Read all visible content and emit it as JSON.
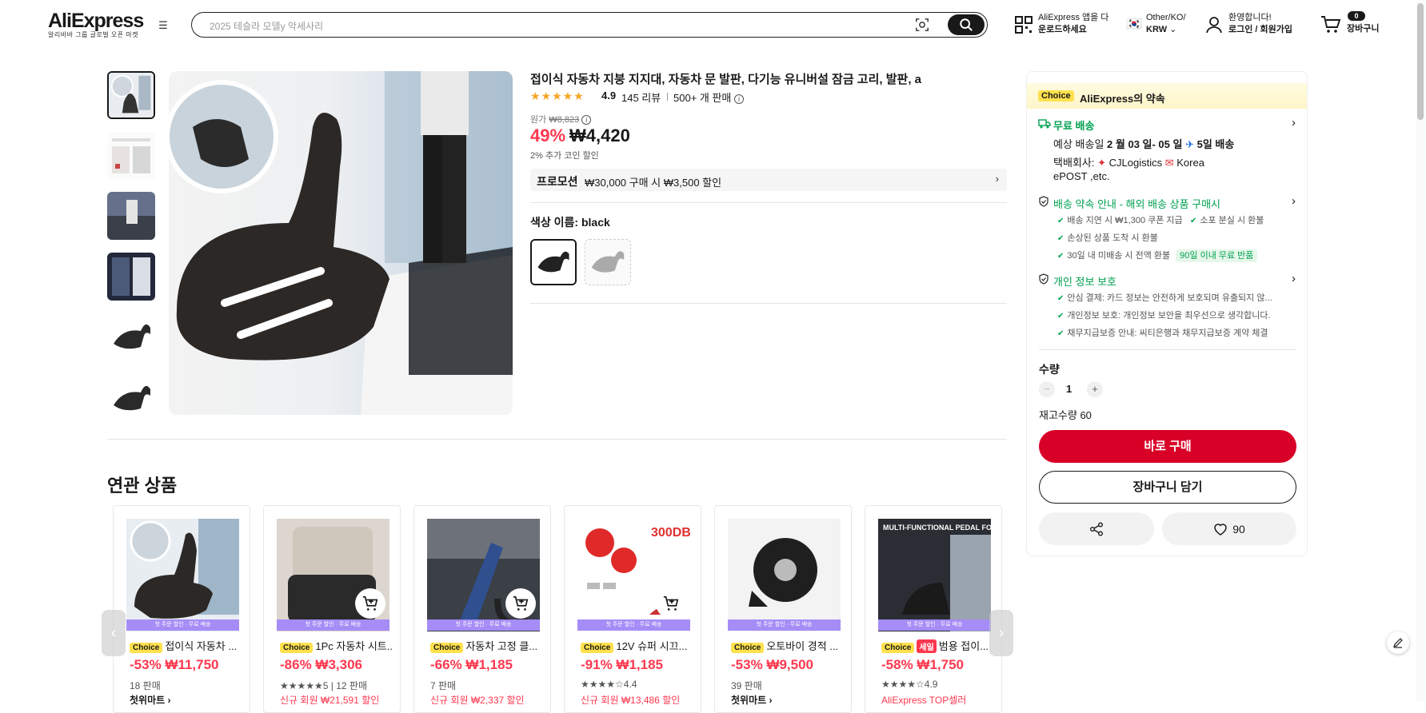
{
  "header": {
    "logo": "AliExpress",
    "logo_sub": "알리바바 그룹 글로벌 오픈 마켓",
    "search_placeholder": "2025 테슬라 모델y 악세사리",
    "app_line1": "AliExpress 앱을 다",
    "app_line2": "운로드하세요",
    "region_line1": "Other/KO/",
    "region_line2": "KRW",
    "account_line1": "환영합니다!",
    "account_line2": "로그인 / 회원가입",
    "cart_count": "0",
    "cart_label": "장바구니"
  },
  "product": {
    "title": "접이식 자동차 지붕 지지대, 자동차 문 발판, 다기능 유니버설 잠금 고리, 발판, a",
    "stars": "★★★★★",
    "rating": "4.9",
    "reviews": "145 리뷰",
    "sold": "500+ 개 판매",
    "orig_label": "원가",
    "orig_price": "₩8,823",
    "discount": "49%",
    "price": "₩4,420",
    "coin": "2% 추가 코인 할인",
    "promo_tag": "프로모션",
    "promo_text": "₩30,000 구매 시 ₩3,500 할인",
    "color_label": "색상 이름: black",
    "thumb_count": 6
  },
  "panel": {
    "choice": "Choice",
    "promise": "AliExpress의 약속",
    "free_ship": "무료 배송",
    "delivery_prefix": "예상 배송일",
    "delivery_date": "2 월 03 일- 05 일",
    "delivery_days": "5일 배송",
    "carrier_label": "택배회사:",
    "carrier1": "CJLogistics",
    "carrier2": "Korea",
    "carrier3": "ePOST ,etc.",
    "guarantee_title": "배송 약속 안내 - 해외 배송 상품 구매시",
    "g1": "배송 지연 시 ₩1,300 쿠폰 지급",
    "g2": "소포 분실 시 환불",
    "g3": "손상된 상품 도착 시 환불",
    "g4": "30일 내 미배송 시 전액 환불",
    "g4_badge": "90일 이내 무료 반품",
    "privacy_title": "개인 정보 보호",
    "p1": "안심 결제: 카드 정보는 안전하게 보호되며 유출되지 않...",
    "p2": "개인정보 보호: 개인정보 보안을 최우선으로 생각합니다.",
    "p3": "채무지급보증 안내: 씨티은행과 채무지급보증 계약 체결",
    "qty_label": "수량",
    "qty_minus": "−",
    "qty_value": "1",
    "qty_plus": "+",
    "stock": "재고수량 60",
    "buy_now": "바로 구매",
    "add_cart": "장바구니 담기",
    "wish_count": "90"
  },
  "related": {
    "title": "연관 상품",
    "band": "첫 주문 할인 · 무료 배송",
    "items": [
      {
        "badge": "Choice",
        "title": "접이식 자동차 ...",
        "price": "-53% ₩11,750",
        "sub": "18 판매",
        "extra": "첫위마트 ›"
      },
      {
        "badge": "Choice",
        "title": "1Pc 자동차 시트...",
        "price": "-86% ₩3,306",
        "sub": "★★★★★5 | 12 판매",
        "extra": "신규 회원 ₩21,591 할인"
      },
      {
        "badge": "Choice",
        "title": "자동차 고정 클...",
        "price": "-66% ₩1,185",
        "sub": "7 판매",
        "extra": "신규 회원 ₩2,337 할인"
      },
      {
        "badge": "Choice",
        "title": "12V 슈퍼 시끄...",
        "price": "-91% ₩1,185",
        "sub": "★★★★☆4.4",
        "extra": "신규 회원 ₩13,486 할인"
      },
      {
        "badge": "Choice",
        "title": "오토바이 경적 ...",
        "price": "-53% ₩9,500",
        "sub": "39 판매",
        "extra": "첫위마트 ›"
      },
      {
        "badge": "Choice",
        "sale": "세일",
        "title": "범용 접이...",
        "price": "-58% ₩1,750",
        "sub": "★★★★☆4.9",
        "extra": "AliExpress TOP셀러"
      }
    ],
    "card6_text": "MULTI-FUNCTIONAL PEDAL FOR CARS",
    "card4_text": "300DB"
  }
}
